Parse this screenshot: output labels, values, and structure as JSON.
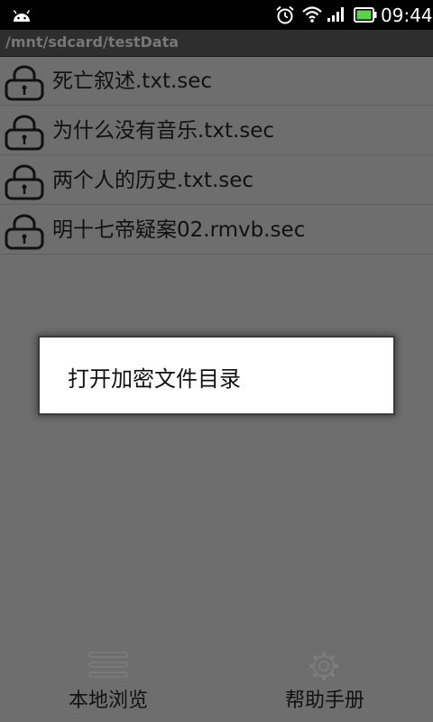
{
  "status_bar": {
    "time": "09:44",
    "icons": [
      "android-icon",
      "alarm-icon",
      "wifi-icon",
      "signal-icon",
      "battery-icon"
    ]
  },
  "path_bar": {
    "path": "/mnt/sdcard/testData"
  },
  "files": [
    {
      "name": "死亡叙述.txt.sec",
      "icon": "lock-icon"
    },
    {
      "name": "为什么没有音乐.txt.sec",
      "icon": "lock-icon"
    },
    {
      "name": "两个人的历史.txt.sec",
      "icon": "lock-icon"
    },
    {
      "name": "明十七帝疑案02.rmvb.sec",
      "icon": "lock-icon"
    }
  ],
  "dialog": {
    "item_label": "打开加密文件目录"
  },
  "bottom_nav": {
    "local_browse": {
      "label": "本地浏览",
      "icon": "list-icon"
    },
    "help_manual": {
      "label": "帮助手册",
      "icon": "gear-icon"
    }
  },
  "colors": {
    "overlay_background": "#6e6e6e",
    "battery_green": "#5fd04a",
    "dialog_background": "#ffffff"
  }
}
